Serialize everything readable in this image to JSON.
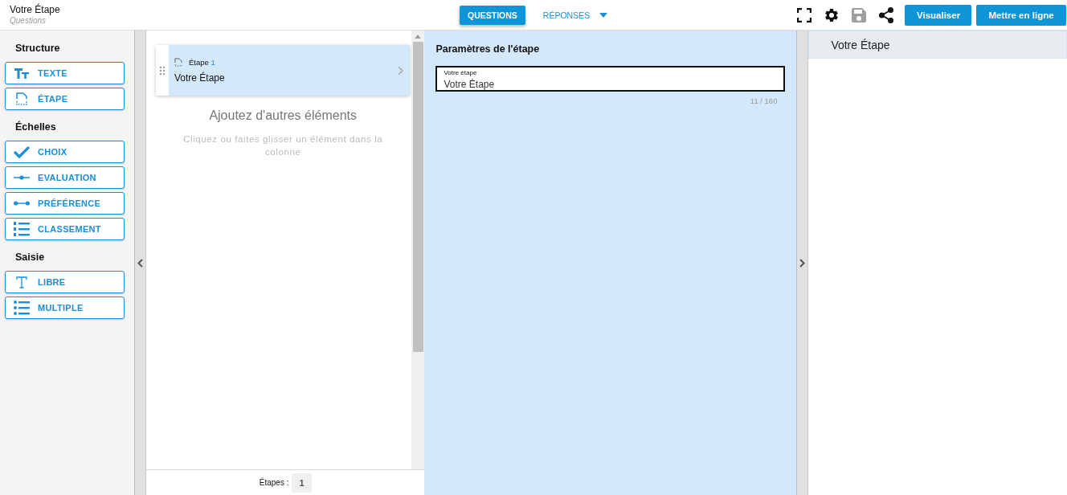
{
  "header": {
    "title": "Votre Étape",
    "subtitle": "Questions"
  },
  "tabs": [
    {
      "label": "QUESTIONS",
      "selected": true,
      "kind": "plain"
    },
    {
      "label": "RÉPONSES",
      "selected": false,
      "kind": "dropdown"
    }
  ],
  "toolbar": {
    "icons": [
      {
        "kind": "fullscreen",
        "disabled": false
      },
      {
        "kind": "settings",
        "disabled": false
      },
      {
        "kind": "save",
        "disabled": true
      },
      {
        "kind": "share",
        "disabled": false
      }
    ],
    "buttons": [
      "Visualiser",
      "Mettre en ligne"
    ]
  },
  "palette": [
    {
      "title": "Structure",
      "items": [
        {
          "label": "TEXTE",
          "kind": "text"
        },
        {
          "label": "ÉTAPE",
          "kind": "step"
        }
      ]
    },
    {
      "title": "Échelles",
      "items": [
        {
          "label": "CHOIX",
          "kind": "check"
        },
        {
          "label": "EVALUATION",
          "kind": "slider"
        },
        {
          "label": "PRÉFÉRENCE",
          "kind": "range"
        },
        {
          "label": "CLASSEMENT",
          "kind": "ranking"
        }
      ]
    },
    {
      "title": "Saisie",
      "items": [
        {
          "label": "LIBRE",
          "kind": "free"
        },
        {
          "label": "MULTIPLE",
          "kind": "list"
        }
      ]
    }
  ],
  "steps": [
    {
      "caption": "Étape",
      "number": "1",
      "title": "Votre Étape",
      "selected": true
    }
  ],
  "empty_state": {
    "heading": "Ajoutez d'autres éléments",
    "hint": "Cliquez ou faites glisser un élément dans la colonne"
  },
  "footer": {
    "label": "Étapes :",
    "count": "1"
  },
  "settings": {
    "heading": "Paramètres de l'étape",
    "field": {
      "label": "Votre étape",
      "value": "Votre Étape",
      "counter": "11 / 160"
    }
  },
  "preview": {
    "title": "Votre Étape"
  }
}
